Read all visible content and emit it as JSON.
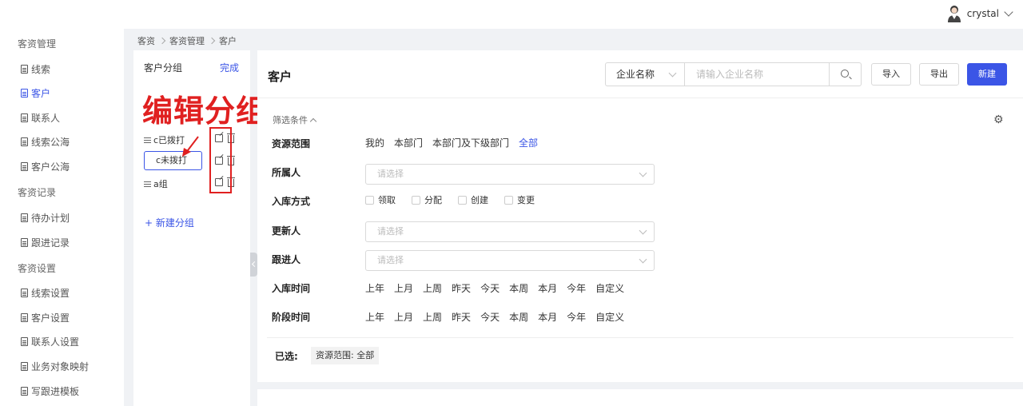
{
  "user": {
    "name": "crystal"
  },
  "sidebar": {
    "groups": [
      {
        "label": "客资管理",
        "items": [
          "线索",
          "客户",
          "联系人",
          "线索公海",
          "客户公海"
        ]
      },
      {
        "label": "客资记录",
        "items": [
          "待办计划",
          "跟进记录"
        ]
      },
      {
        "label": "客资设置",
        "items": [
          "线索设置",
          "客户设置",
          "联系人设置",
          "业务对象映射",
          "写跟进模板"
        ]
      }
    ],
    "active_item": "客户"
  },
  "breadcrumb": [
    "客资",
    "客资管理",
    "客户"
  ],
  "group_panel": {
    "title": "客户分组",
    "done_label": "完成",
    "annotation": "编辑分组",
    "groups": [
      "c已拨打",
      "c未拨打",
      "a组"
    ],
    "new_group_label": "+ 新建分组"
  },
  "main": {
    "title": "客户",
    "search": {
      "field": "企业名称",
      "placeholder": "请输入企业名称"
    },
    "buttons": {
      "import": "导入",
      "export": "导出",
      "create": "新建"
    },
    "filter_toggle": "筛选条件",
    "filters": {
      "scope": {
        "label": "资源范围",
        "options": [
          "我的",
          "本部门",
          "本部门及下级部门",
          "全部"
        ],
        "selected": "全部"
      },
      "owner": {
        "label": "所属人",
        "placeholder": "请选择"
      },
      "intake_method": {
        "label": "入库方式",
        "options": [
          "领取",
          "分配",
          "创建",
          "变更"
        ]
      },
      "updater": {
        "label": "更新人",
        "placeholder": "请选择"
      },
      "follower": {
        "label": "跟进人",
        "placeholder": "请选择"
      },
      "intake_time": {
        "label": "入库时间",
        "options": [
          "上年",
          "上月",
          "上周",
          "昨天",
          "今天",
          "本周",
          "本月",
          "今年",
          "自定义"
        ]
      },
      "stage_time": {
        "label": "阶段时间",
        "options": [
          "上年",
          "上月",
          "上周",
          "昨天",
          "今天",
          "本周",
          "本月",
          "今年",
          "自定义"
        ]
      }
    },
    "chosen": {
      "label": "已选:",
      "tag": "资源范围: 全部"
    }
  },
  "colors": {
    "accent": "#3b55e6",
    "annotation": "#e02020"
  }
}
